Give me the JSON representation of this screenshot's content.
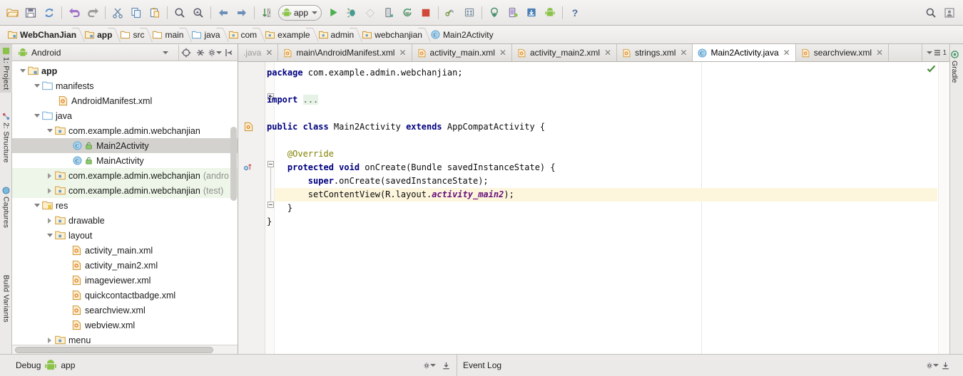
{
  "toolbar": {
    "buttons": [
      {
        "name": "open-folder-icon",
        "title": "Open"
      },
      {
        "name": "save-all-icon",
        "title": "Save All"
      },
      {
        "name": "sync-icon",
        "title": "Synchronize"
      },
      {
        "name": "undo-icon",
        "title": "Undo"
      },
      {
        "name": "redo-icon",
        "title": "Redo"
      },
      {
        "name": "cut-icon",
        "title": "Cut"
      },
      {
        "name": "copy-icon",
        "title": "Copy"
      },
      {
        "name": "paste-icon",
        "title": "Paste"
      },
      {
        "name": "find-icon",
        "title": "Find"
      },
      {
        "name": "replace-icon",
        "title": "Replace"
      },
      {
        "name": "back-icon",
        "title": "Back"
      },
      {
        "name": "forward-icon",
        "title": "Forward"
      },
      {
        "name": "compare-icon",
        "title": "Compare"
      }
    ],
    "run_config": "app",
    "right_buttons": [
      {
        "name": "run-icon",
        "title": "Run"
      },
      {
        "name": "debug-icon",
        "title": "Debug"
      },
      {
        "name": "coverage-icon",
        "title": "Run with Coverage"
      },
      {
        "name": "attach-debugger-icon",
        "title": "Attach Debugger"
      },
      {
        "name": "rerun-icon",
        "title": "Rerun"
      },
      {
        "name": "stop-icon",
        "title": "Stop"
      },
      {
        "name": "sdk-manager-icon",
        "title": "SDK Manager"
      },
      {
        "name": "avd-manager-icon",
        "title": "AVD Manager"
      },
      {
        "name": "sync-gradle-icon",
        "title": "Sync Project"
      },
      {
        "name": "device-monitor-icon",
        "title": "Android Device Monitor"
      },
      {
        "name": "layout-inspector-icon",
        "title": "Layout Inspector"
      },
      {
        "name": "android-icon",
        "title": "Android"
      },
      {
        "name": "help-icon",
        "title": "Help"
      }
    ],
    "far_right": [
      {
        "name": "search-everywhere-icon",
        "title": "Search"
      },
      {
        "name": "account-icon",
        "title": "Account"
      }
    ]
  },
  "breadcrumb": [
    {
      "label": "WebChanJian",
      "icon": "module-icon",
      "bold": true
    },
    {
      "label": "app",
      "icon": "module-icon",
      "bold": true
    },
    {
      "label": "src",
      "icon": "folder-icon",
      "bold": false
    },
    {
      "label": "main",
      "icon": "folder-icon",
      "bold": false
    },
    {
      "label": "java",
      "icon": "source-folder-icon",
      "bold": false
    },
    {
      "label": "com",
      "icon": "package-icon",
      "bold": false
    },
    {
      "label": "example",
      "icon": "package-icon",
      "bold": false
    },
    {
      "label": "admin",
      "icon": "package-icon",
      "bold": false
    },
    {
      "label": "webchanjian",
      "icon": "package-icon",
      "bold": false
    },
    {
      "label": "Main2Activity",
      "icon": "class-icon",
      "bold": false
    }
  ],
  "left_tool_tabs": [
    {
      "label": "1: Project",
      "icon": "project-icon",
      "selected": true
    },
    {
      "label": "2: Structure",
      "icon": "structure-icon",
      "selected": false
    },
    {
      "label": "Captures",
      "icon": "captures-icon",
      "selected": false
    },
    {
      "label": "Build Variants",
      "icon": "build-variants-icon",
      "selected": false
    }
  ],
  "right_tool_tabs": [
    {
      "label": "Gradle",
      "icon": "gradle-icon"
    }
  ],
  "project_panel": {
    "view_selector": "Android",
    "view_selector_icon": "android-icon",
    "header_buttons": [
      {
        "name": "target-icon",
        "title": "Select Opened File"
      },
      {
        "name": "collapse-all-icon",
        "title": "Collapse All"
      },
      {
        "name": "settings-gear-icon",
        "title": "Settings"
      },
      {
        "name": "hide-icon",
        "title": "Hide"
      }
    ],
    "tree": [
      {
        "label": "app",
        "indent": 0,
        "arrow": "down",
        "icon": "module-icon",
        "bold": true,
        "suffix": "",
        "state": "none"
      },
      {
        "label": "manifests",
        "indent": 1,
        "arrow": "down",
        "icon": "folder-icon",
        "bold": false,
        "suffix": "",
        "state": "none"
      },
      {
        "label": "AndroidManifest.xml",
        "indent": 2,
        "arrow": "none",
        "icon": "xml-file-icon",
        "bold": false,
        "suffix": "",
        "state": "none"
      },
      {
        "label": "java",
        "indent": 1,
        "arrow": "down",
        "icon": "folder-icon",
        "bold": false,
        "suffix": "",
        "state": "none"
      },
      {
        "label": "com.example.admin.webchanjian",
        "indent": 2,
        "arrow": "down",
        "icon": "package-icon",
        "bold": false,
        "suffix": "",
        "state": "none"
      },
      {
        "label": "Main2Activity",
        "indent": 3,
        "arrow": "none",
        "icon": "java-class-icon",
        "bold": false,
        "suffix": "",
        "state": "selected"
      },
      {
        "label": "MainActivity",
        "indent": 3,
        "arrow": "none",
        "icon": "java-class-icon",
        "bold": false,
        "suffix": "",
        "state": "none"
      },
      {
        "label": "com.example.admin.webchanjian",
        "indent": 2,
        "arrow": "right",
        "icon": "package-icon",
        "bold": false,
        "suffix": "(andro",
        "state": "green"
      },
      {
        "label": "com.example.admin.webchanjian",
        "indent": 2,
        "arrow": "right",
        "icon": "package-icon",
        "bold": false,
        "suffix": "(test)",
        "state": "green"
      },
      {
        "label": "res",
        "indent": 1,
        "arrow": "down",
        "icon": "res-folder-icon",
        "bold": false,
        "suffix": "",
        "state": "none"
      },
      {
        "label": "drawable",
        "indent": 2,
        "arrow": "right",
        "icon": "package-icon",
        "bold": false,
        "suffix": "",
        "state": "none"
      },
      {
        "label": "layout",
        "indent": 2,
        "arrow": "down",
        "icon": "package-icon",
        "bold": false,
        "suffix": "",
        "state": "none"
      },
      {
        "label": "activity_main.xml",
        "indent": 3,
        "arrow": "none",
        "icon": "xml-file-icon",
        "bold": false,
        "suffix": "",
        "state": "none"
      },
      {
        "label": "activity_main2.xml",
        "indent": 3,
        "arrow": "none",
        "icon": "xml-file-icon",
        "bold": false,
        "suffix": "",
        "state": "none"
      },
      {
        "label": "imageviewer.xml",
        "indent": 3,
        "arrow": "none",
        "icon": "xml-file-icon",
        "bold": false,
        "suffix": "",
        "state": "none"
      },
      {
        "label": "quickcontactbadge.xml",
        "indent": 3,
        "arrow": "none",
        "icon": "xml-file-icon",
        "bold": false,
        "suffix": "",
        "state": "none"
      },
      {
        "label": "searchview.xml",
        "indent": 3,
        "arrow": "none",
        "icon": "xml-file-icon",
        "bold": false,
        "suffix": "",
        "state": "none"
      },
      {
        "label": "webview.xml",
        "indent": 3,
        "arrow": "none",
        "icon": "xml-file-icon",
        "bold": false,
        "suffix": "",
        "state": "none"
      },
      {
        "label": "menu",
        "indent": 2,
        "arrow": "right",
        "icon": "package-icon",
        "bold": false,
        "suffix": "",
        "state": "none"
      }
    ]
  },
  "editor": {
    "tabs": [
      {
        "label": ".java",
        "icon": "java-class-icon",
        "active": false,
        "dim": true
      },
      {
        "label": "main\\AndroidManifest.xml",
        "icon": "xml-file-icon",
        "active": false,
        "dim": false
      },
      {
        "label": "activity_main.xml",
        "icon": "xml-file-icon",
        "active": false,
        "dim": false
      },
      {
        "label": "activity_main2.xml",
        "icon": "xml-file-icon",
        "active": false,
        "dim": false
      },
      {
        "label": "strings.xml",
        "icon": "xml-file-icon",
        "active": false,
        "dim": false
      },
      {
        "label": "Main2Activity.java",
        "icon": "java-class-icon",
        "active": true,
        "dim": false
      },
      {
        "label": "searchview.xml",
        "icon": "xml-file-icon",
        "active": false,
        "dim": false
      }
    ],
    "tab_overflow_count": "1",
    "inspection_status": "ok",
    "code_lines": [
      "package com.example.admin.webchanjian;",
      "",
      "import ...",
      "",
      "public class Main2Activity extends AppCompatActivity {",
      "",
      "    @Override",
      "    protected void onCreate(Bundle savedInstanceState) {",
      "        super.onCreate(savedInstanceState);",
      "        setContentView(R.layout.activity_main2);",
      "    }",
      "}"
    ],
    "caret_line_index": 9,
    "gutter_markers": [
      {
        "name": "class-bookmark-icon",
        "line": 4
      },
      {
        "name": "override-method-icon",
        "line": 7
      }
    ]
  },
  "status_bar": {
    "debug_label": "Debug",
    "debug_target": "app",
    "debug_target_icon": "android-icon",
    "debug_buttons": [
      {
        "name": "settings-gear-icon",
        "title": "Settings"
      },
      {
        "name": "hide-panel-icon",
        "title": "Hide"
      }
    ],
    "event_log_label": "Event Log",
    "event_log_buttons": [
      {
        "name": "settings-gear-icon",
        "title": "Settings"
      },
      {
        "name": "hide-panel-icon",
        "title": "Hide"
      }
    ]
  },
  "colors": {
    "keyword": "#000080",
    "annotation": "#808000",
    "field": "#660e7a",
    "caret_line": "#fdf6dd",
    "selection": "#d4d2cf",
    "test_source": "#edf6e8",
    "chrome": "#eceae8"
  }
}
